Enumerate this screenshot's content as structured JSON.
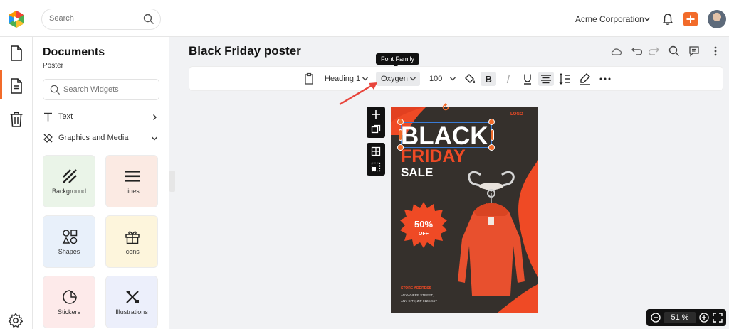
{
  "app": {
    "accent_color": "#f26b2a",
    "logo_icon": "app-logo-icon"
  },
  "topbar": {
    "search_placeholder": "Search",
    "organization": "Acme Corporation"
  },
  "rail": {
    "items": [
      "documents-icon",
      "document-text-icon",
      "trash-icon"
    ],
    "settings_icon": "gear-icon"
  },
  "panel": {
    "title": "Documents",
    "subtitle": "Poster",
    "search_placeholder": "Search Widgets",
    "sections": [
      {
        "label": "Text",
        "icon": "text-icon",
        "expanded": false
      },
      {
        "label": "Graphics and Media",
        "icon": "graphics-icon",
        "expanded": true
      }
    ],
    "tiles": [
      {
        "label": "Background",
        "color": "#eaf4e8"
      },
      {
        "label": "Lines",
        "color": "#fbeae3"
      },
      {
        "label": "Shapes",
        "color": "#e8f0fa"
      },
      {
        "label": "Icons",
        "color": "#fdf5dc"
      },
      {
        "label": "Stickers",
        "color": "#fdeaea"
      },
      {
        "label": "Illustrations",
        "color": "#eceffb"
      }
    ]
  },
  "editor": {
    "document_title": "Black Friday poster",
    "tooltip": "Font Family",
    "format": {
      "style": "Heading 1",
      "font": "Oxygen",
      "size": "100"
    },
    "zoom": "51 %"
  },
  "poster": {
    "logo": "LOGO",
    "line1": "BLACK",
    "line2": "FRIDAY",
    "line3": "SALE",
    "discount": "50%",
    "discount_sub": "OFF",
    "store_label": "STORE ADDRESS",
    "address_line1": "ANYWHERE STREET,",
    "address_line2": "ANY CITY, ZIP 01234567",
    "accent": "#ef4a25",
    "background": "#35302c"
  }
}
